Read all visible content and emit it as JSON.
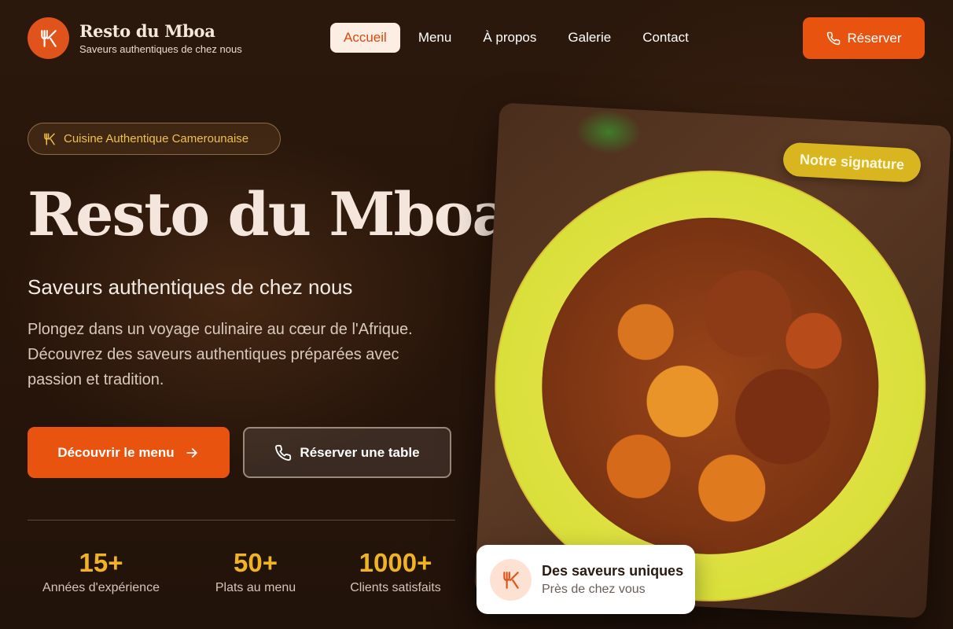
{
  "brand": {
    "title": "Resto du Mboa",
    "subtitle": "Saveurs authentiques de chez nous"
  },
  "nav": {
    "items": [
      {
        "label": "Accueil",
        "active": true
      },
      {
        "label": "Menu"
      },
      {
        "label": "À propos"
      },
      {
        "label": "Galerie"
      },
      {
        "label": "Contact"
      }
    ],
    "cta": "Réserver"
  },
  "hero": {
    "badge": "Cuisine Authentique Camerounaise",
    "title": "Resto du Mboa",
    "subtitle": "Saveurs authentiques de chez nous",
    "description": "Plongez dans un voyage culinaire au cœur de l'Afrique. Découvrez des saveurs authentiques préparées avec passion et tradition.",
    "primary_button": "Découvrir le menu",
    "secondary_button": "Réserver une table"
  },
  "stats": [
    {
      "value": "15+",
      "label": "Années d'expérience"
    },
    {
      "value": "50+",
      "label": "Plats au menu"
    },
    {
      "value": "1000+",
      "label": "Clients satisfaits"
    }
  ],
  "image": {
    "signature_tag": "Notre signature"
  },
  "float_card": {
    "title": "Des saveurs uniques",
    "subtitle": "Près de chez vous"
  },
  "colors": {
    "accent": "#e8530f",
    "gold": "#f0b323",
    "background": "#2b180c"
  }
}
